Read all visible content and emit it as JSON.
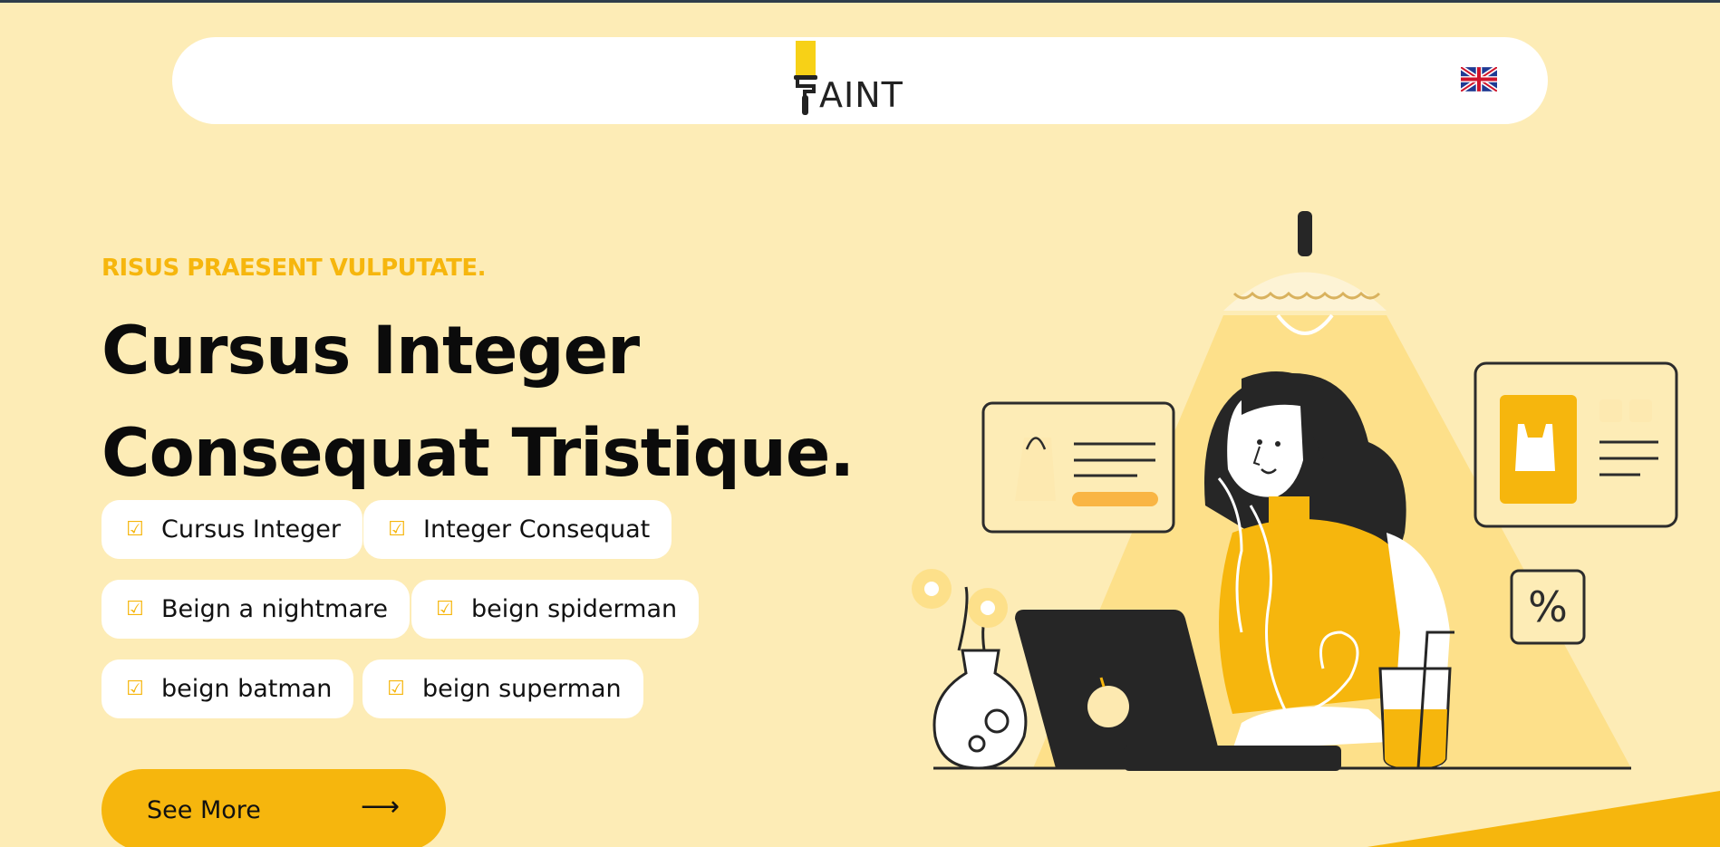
{
  "navbar": {
    "logo_text": "AINT",
    "language_flag": "uk-flag-icon"
  },
  "hero": {
    "eyebrow": "RISUS PRAESENT VULPUTATE.",
    "headline_line1": "Cursus Integer",
    "headline_line2": "Consequat Tristique.",
    "tags": [
      "Cursus Integer",
      "Integer Consequat",
      "Beign a nightmare",
      "beign spiderman",
      "beign batman",
      "beign superman"
    ],
    "check_icon": "checkbox-check-icon",
    "cta_label": "See More",
    "cta_arrow": "⟶"
  },
  "colors": {
    "background": "#fdecb6",
    "accent": "#f6b60d",
    "card": "#ffffff",
    "dark": "#262626"
  },
  "illustration": {
    "name": "woman-working-on-laptop-illustration",
    "percent_symbol": "%"
  }
}
